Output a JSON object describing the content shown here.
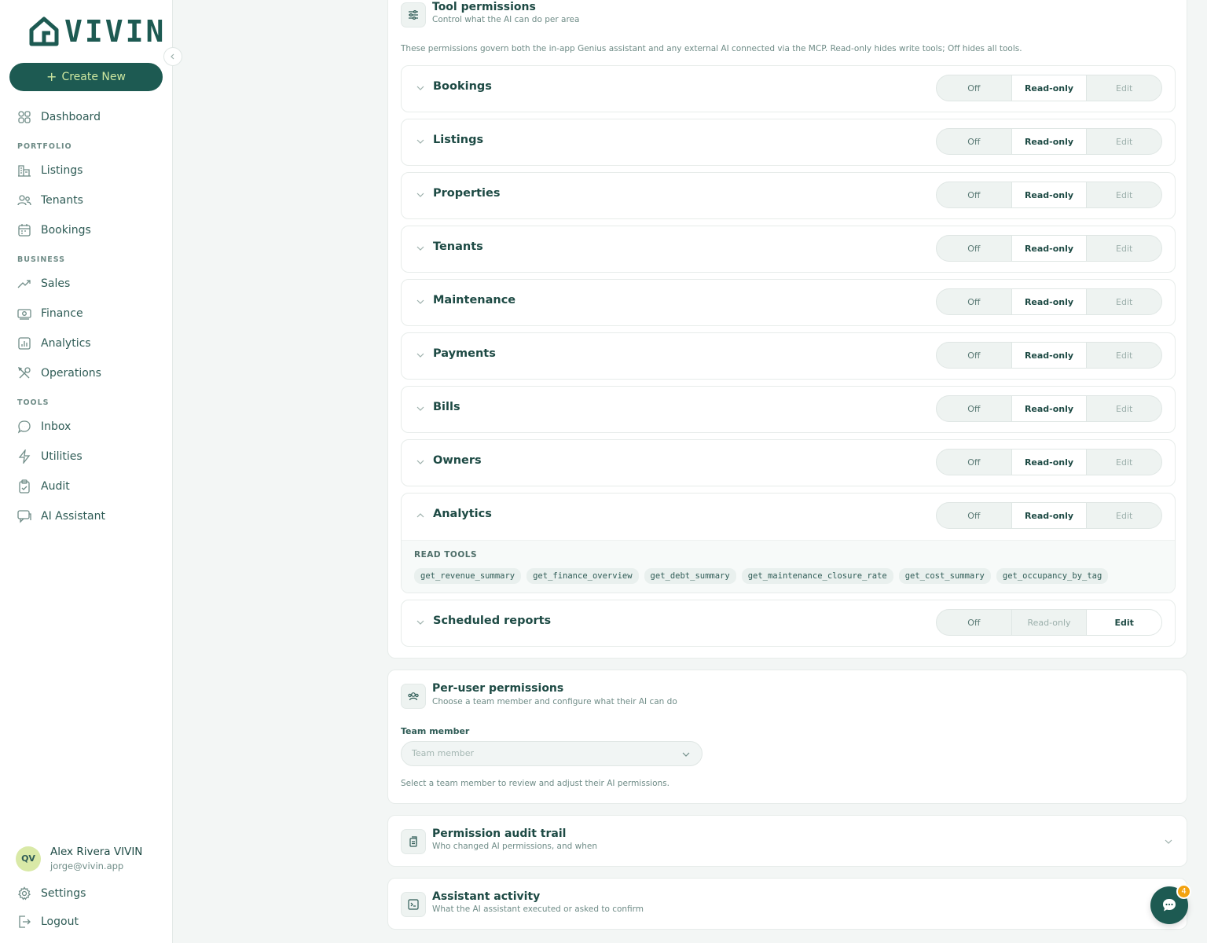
{
  "brand": {
    "logo_text": "VIVIN",
    "primary": "#1d5a52",
    "accent": "#cde7a0"
  },
  "sidebar": {
    "create_label": "Create New",
    "dashboard": "Dashboard",
    "sections": {
      "portfolio": "PORTFOLIO",
      "business": "BUSINESS",
      "tools": "TOOLS"
    },
    "items": {
      "listings": "Listings",
      "tenants": "Tenants",
      "bookings": "Bookings",
      "sales": "Sales",
      "finance": "Finance",
      "analytics": "Analytics",
      "operations": "Operations",
      "inbox": "Inbox",
      "utilities": "Utilities",
      "audit": "Audit",
      "ai_assistant": "AI Assistant"
    },
    "user": {
      "initials": "QV",
      "name": "Alex Rivera VIVIN",
      "email": "jorge@vivin.app"
    },
    "settings": "Settings",
    "logout": "Logout"
  },
  "tool_permissions": {
    "title": "Tool permissions",
    "subtitle": "Control what the AI can do per area",
    "description": "These permissions govern both the in-app Genius assistant and any external AI connected via the MCP. Read-only hides write tools; Off hides all tools.",
    "options": {
      "off": "Off",
      "read": "Read-only",
      "edit": "Edit"
    },
    "areas": [
      {
        "name": "Bookings",
        "level": "Read-only"
      },
      {
        "name": "Listings",
        "level": "Read-only"
      },
      {
        "name": "Properties",
        "level": "Read-only"
      },
      {
        "name": "Tenants",
        "level": "Read-only"
      },
      {
        "name": "Maintenance",
        "level": "Read-only"
      },
      {
        "name": "Payments",
        "level": "Read-only"
      },
      {
        "name": "Bills",
        "level": "Read-only"
      },
      {
        "name": "Owners",
        "level": "Read-only"
      },
      {
        "name": "Analytics",
        "level": "Read-only"
      },
      {
        "name": "Scheduled reports",
        "level": "Edit"
      }
    ],
    "analytics_expanded": {
      "read_tools_label": "READ TOOLS",
      "tools": [
        "get_revenue_summary",
        "get_finance_overview",
        "get_debt_summary",
        "get_maintenance_closure_rate",
        "get_cost_summary",
        "get_occupancy_by_tag"
      ]
    }
  },
  "per_user": {
    "title": "Per-user permissions",
    "subtitle": "Choose a team member and configure what their AI can do",
    "field_label": "Team member",
    "placeholder": "Team member",
    "helper": "Select a team member to review and adjust their AI permissions."
  },
  "audit_trail": {
    "title": "Permission audit trail",
    "subtitle": "Who changed AI permissions, and when"
  },
  "assistant_activity": {
    "title": "Assistant activity",
    "subtitle": "What the AI assistant executed or asked to confirm"
  },
  "chat": {
    "badge": "4"
  }
}
